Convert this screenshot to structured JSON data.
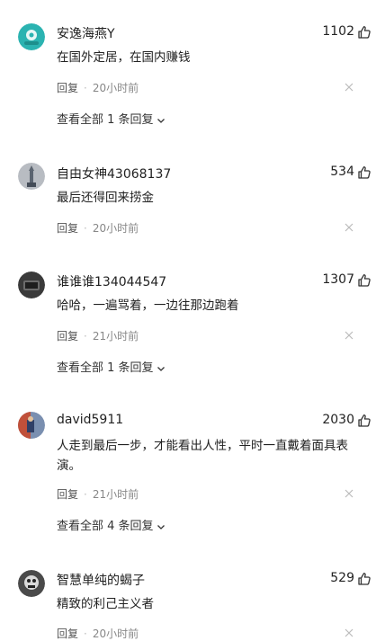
{
  "comments": [
    {
      "username": "安逸海燕Y",
      "likes": "1102",
      "text": "在国外定居，在国内赚钱",
      "reply_label": "回复",
      "time": "20小时前",
      "view_replies": "查看全部 1 条回复"
    },
    {
      "username": "自由女神43068137",
      "likes": "534",
      "text": "最后还得回来捞金",
      "reply_label": "回复",
      "time": "20小时前"
    },
    {
      "username": "谁谁谁134044547",
      "likes": "1307",
      "text": "哈哈，一遍骂着，一边往那边跑着",
      "reply_label": "回复",
      "time": "21小时前",
      "view_replies": "查看全部 1 条回复"
    },
    {
      "username": "david5911",
      "likes": "2030",
      "text": "人走到最后一步，才能看出人性，平时一直戴着面具表演。",
      "reply_label": "回复",
      "time": "21小时前",
      "view_replies": "查看全部 4 条回复"
    },
    {
      "username": "智慧单纯的蝎子",
      "likes": "529",
      "text": "精致的利己主义者",
      "reply_label": "回复",
      "time": "20小时前"
    }
  ],
  "separator": "·",
  "colors": {
    "text": "#222222",
    "meta": "#888888",
    "accent_teal": "#2bb3b1"
  }
}
